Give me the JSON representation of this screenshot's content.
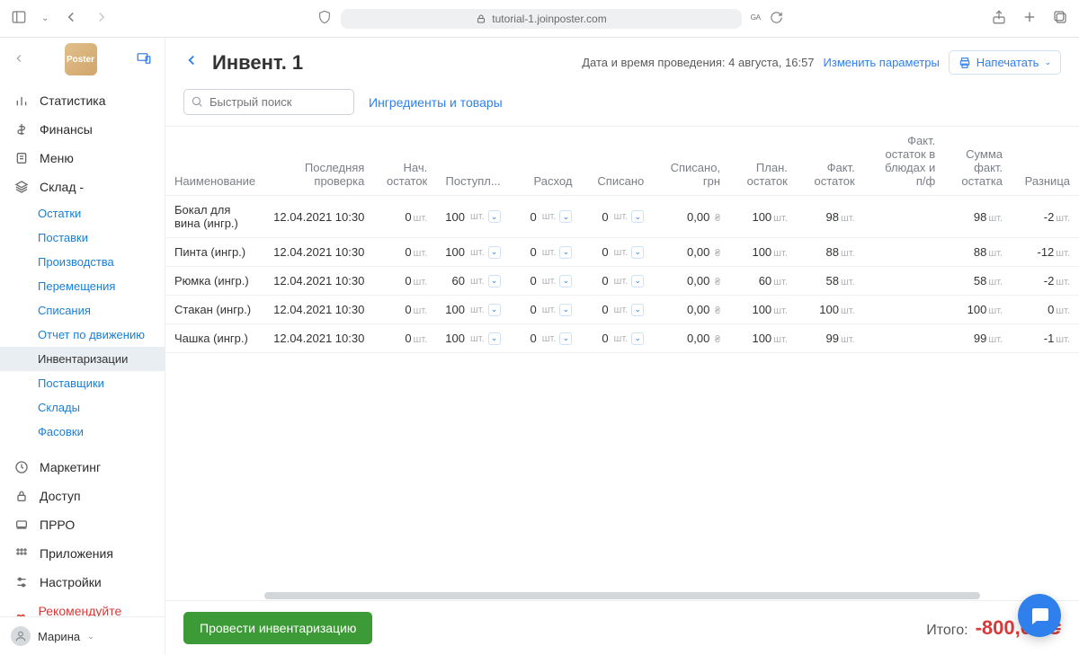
{
  "browser": {
    "url": "tutorial-1.joinposter.com"
  },
  "logo_text": "Poster",
  "sidebar": {
    "items": [
      {
        "label": "Статистика",
        "icon": "stats"
      },
      {
        "label": "Финансы",
        "icon": "dollar"
      },
      {
        "label": "Меню",
        "icon": "doc"
      }
    ],
    "warehouse_label": "Склад -",
    "warehouse_sub": [
      "Остатки",
      "Поставки",
      "Производства",
      "Перемещения",
      "Списания",
      "Отчет по движению",
      "Инвентаризации",
      "Поставщики",
      "Склады",
      "Фасовки"
    ],
    "items2": [
      {
        "label": "Маркетинг",
        "icon": "clock"
      },
      {
        "label": "Доступ",
        "icon": "lock"
      },
      {
        "label": "ПРРО",
        "icon": "receipt"
      },
      {
        "label": "Приложения",
        "icon": "grid"
      },
      {
        "label": "Настройки",
        "icon": "gear"
      },
      {
        "label": "Рекомендуйте Poster",
        "icon": "gift"
      }
    ],
    "user": "Марина"
  },
  "header": {
    "title": "Инвент. 1",
    "meta_label": "Дата и время проведения:",
    "meta_value": "4 августа, 16:57",
    "change_params": "Изменить параметры",
    "print": "Напечатать"
  },
  "toolbar": {
    "search_placeholder": "Быстрый поиск",
    "ingredients_link": "Ингредиенты и товары"
  },
  "table": {
    "headers": {
      "name": "Наименование",
      "last_check": "Последняя проверка",
      "start_balance": "Нач. остаток",
      "incoming": "Поступл...",
      "expense": "Расход",
      "writeoff": "Списано",
      "writeoff_uah": "Списано, грн",
      "plan_balance": "План. остаток",
      "fact_balance": "Факт. остаток",
      "fact_in_dish": "Факт. остаток в блюдах и п/ф",
      "sum_fact": "Сумма факт. остатка",
      "diff": "Разница"
    },
    "unit": "шт.",
    "currency": "₴",
    "rows": [
      {
        "name": "Бокал для вина (ингр.)",
        "last": "12.04.2021 10:30",
        "start": 0,
        "in": 100,
        "exp": 0,
        "wo": 0,
        "wo_uah": "0,00",
        "plan": 100,
        "fact": 98,
        "fact_dish": "",
        "sum": 98,
        "diff": -2
      },
      {
        "name": "Пинта (ингр.)",
        "last": "12.04.2021 10:30",
        "start": 0,
        "in": 100,
        "exp": 0,
        "wo": 0,
        "wo_uah": "0,00",
        "plan": 100,
        "fact": 88,
        "fact_dish": "",
        "sum": 88,
        "diff": -12
      },
      {
        "name": "Рюмка (ингр.)",
        "last": "12.04.2021 10:30",
        "start": 0,
        "in": 60,
        "exp": 0,
        "wo": 0,
        "wo_uah": "0,00",
        "plan": 60,
        "fact": 58,
        "fact_dish": "",
        "sum": 58,
        "diff": -2
      },
      {
        "name": "Стакан (ингр.)",
        "last": "12.04.2021 10:30",
        "start": 0,
        "in": 100,
        "exp": 0,
        "wo": 0,
        "wo_uah": "0,00",
        "plan": 100,
        "fact": 100,
        "fact_dish": "",
        "sum": 100,
        "diff": 0
      },
      {
        "name": "Чашка (ингр.)",
        "last": "12.04.2021 10:30",
        "start": 0,
        "in": 100,
        "exp": 0,
        "wo": 0,
        "wo_uah": "0,00",
        "plan": 100,
        "fact": 99,
        "fact_dish": "",
        "sum": 99,
        "diff": -1
      }
    ]
  },
  "footer": {
    "submit": "Провести инвентаризацию",
    "total_label": "Итого:",
    "total_value": "-800,00 ₴"
  }
}
